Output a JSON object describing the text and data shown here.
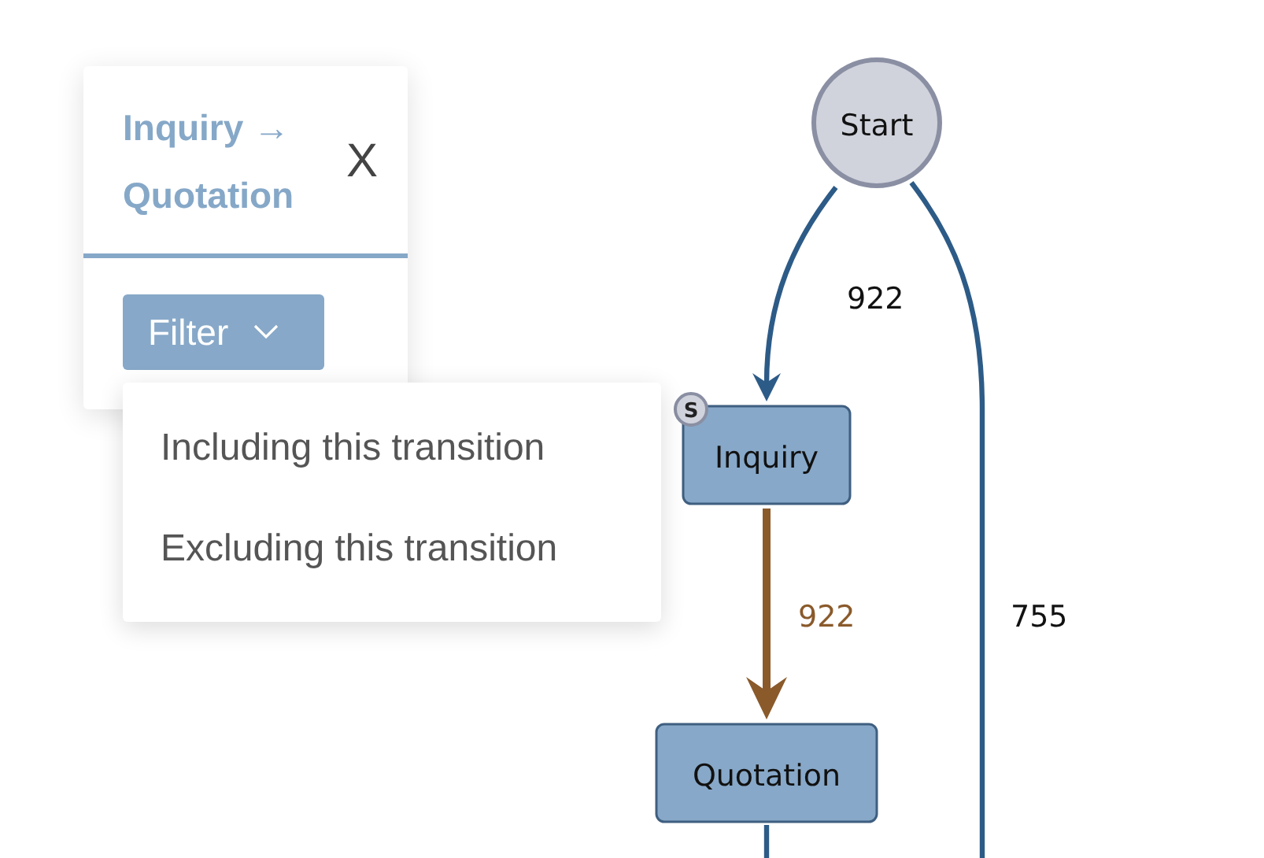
{
  "popup": {
    "title": "Inquiry → Quotation",
    "close": "X",
    "filter_button": "Filter",
    "menu": [
      {
        "label": "Including this transition"
      },
      {
        "label": "Excluding this transition"
      }
    ]
  },
  "graph": {
    "start": {
      "label": "Start"
    },
    "nodes": [
      {
        "label": "Inquiry",
        "badge": "S"
      },
      {
        "label": "Quotation"
      }
    ],
    "edges": [
      {
        "label": "922",
        "selected": false
      },
      {
        "label": "922",
        "selected": true
      },
      {
        "label": "755",
        "selected": false
      }
    ]
  }
}
